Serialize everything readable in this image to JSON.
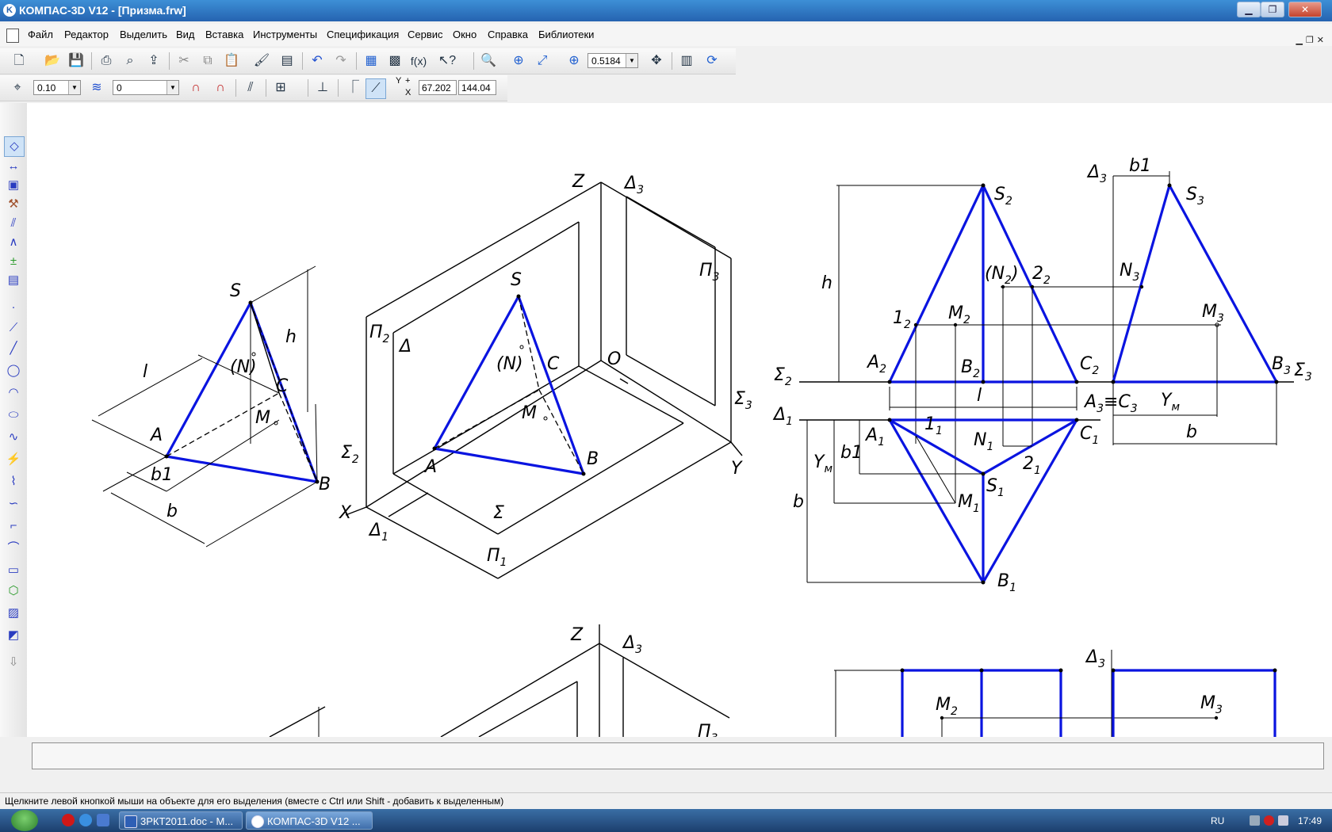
{
  "window": {
    "title": "КОМПАС-3D V12 - [Призма.frw]",
    "app_icon_letter": "K"
  },
  "menu": [
    "Файл",
    "Редактор",
    "Выделить",
    "Вид",
    "Вставка",
    "Инструменты",
    "Спецификация",
    "Сервис",
    "Окно",
    "Справка",
    "Библиотеки"
  ],
  "toolbar1": {
    "zoom_value": "0.5184"
  },
  "toolbar2": {
    "step_value": "0.10",
    "layer_value": "0",
    "coord_label_y": "Y",
    "coord_label_x": "X",
    "coord_x": "67.202",
    "coord_y": "144.04"
  },
  "status_text": "Щелкните левой кнопкой мыши на объекте для его выделения (вместе с Ctrl или Shift - добавить к выделенным)",
  "taskbar": {
    "tasks": [
      {
        "label": "3РКТ2011.doc - M..."
      },
      {
        "label": "КОМПАС-3D V12 ..."
      }
    ],
    "language": "RU",
    "clock": "17:49"
  },
  "drawing": {
    "colors": {
      "edge": "#0a14e0",
      "line": "#000000"
    },
    "fig1": {
      "S": "S",
      "A": "A",
      "B": "B",
      "C": "C",
      "M": "M",
      "N": "(N)",
      "l": "l",
      "h": "h",
      "b1": "b1",
      "b": "b"
    },
    "fig2": {
      "Z": "Z",
      "Y": "Y",
      "X": "X",
      "O": "O",
      "S": "S",
      "A": "A",
      "B": "B",
      "C": "C",
      "N": "(N)",
      "M": "M",
      "Delta": "Δ",
      "Sigma": "Σ"
    },
    "fig3": {
      "S2": "S",
      "A2": "A",
      "B2": "B",
      "C2": "C",
      "M2": "M",
      "N2": "(N",
      "N2close": ")",
      "p12": "1",
      "p22": "2",
      "A1": "A",
      "B1": "B",
      "C1": "C",
      "S1": "S",
      "M1": "M",
      "N1": "N",
      "p11": "1",
      "p21": "2",
      "h": "h",
      "l": "l",
      "b1": "b1",
      "b": "b",
      "YM": "Y",
      "Delta": "Δ",
      "Sigma": "Σ"
    },
    "fig4": {
      "S3": "S",
      "N3": "N",
      "M3": "M",
      "B3": "B",
      "A3C3": "A",
      "equiv": "≡",
      "C": "C",
      "b1": "b1",
      "b": "b",
      "YM": "Y",
      "Delta": "Δ",
      "Sigma": "Σ"
    },
    "fig5": {
      "Z": "Z",
      "Delta": "Δ"
    },
    "fig6": {
      "Delta": "Δ",
      "M2": "M",
      "M3": "M"
    },
    "subscripts": {
      "one": "1",
      "two": "2",
      "three": "3",
      "m": "м"
    },
    "planes": {
      "P": "П"
    }
  }
}
